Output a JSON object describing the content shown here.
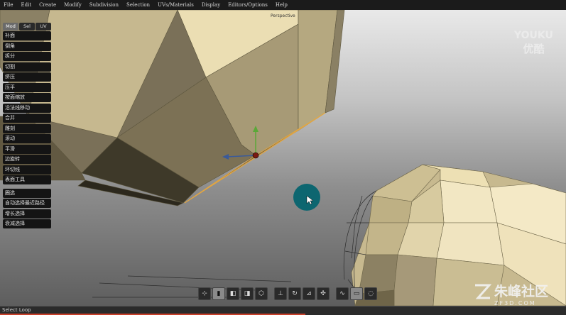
{
  "menu": [
    "File",
    "Edit",
    "Create",
    "Modify",
    "Subdivision",
    "Selection",
    "UVs/Materials",
    "Display",
    "Editors/Options",
    "Help"
  ],
  "viewport_label": "Perspective",
  "panel": {
    "tabs": [
      "Mod",
      "Sel",
      "UV"
    ],
    "active_tab": "Mod",
    "modify_tools": [
      "补面",
      "倒角",
      "拆分",
      "切割",
      "挤压",
      "压平",
      "按面缩放",
      "沿法线移动",
      "合并",
      "雕刻",
      "滚动",
      "平滑",
      "边旋转",
      "环切线",
      "表面工具"
    ],
    "select_tools": [
      "圈选",
      "自动选择最近路径",
      "增长选择",
      "衰减选择"
    ]
  },
  "toolbar_icons": [
    "pivot-icon",
    "face-mode-icon",
    "cube-icon",
    "cube-shaded-icon",
    "cube-outline-icon",
    "move-icon",
    "rotate-icon",
    "scale-icon",
    "universal-icon",
    "curve-icon",
    "rect-select-icon",
    "lasso-select-icon"
  ],
  "status_text": "Select Loop",
  "watermark": {
    "youku_top": "YOUKU",
    "youku_bottom": "优酷",
    "site_cn": "朱峰社区",
    "site_en": "ZF3D.COM"
  },
  "colors": {
    "accent_circle": "#0d6670",
    "status_bar_line": "#c9402a",
    "mesh_light": "#e8dcb4",
    "selection_edge": "#e3a640"
  }
}
